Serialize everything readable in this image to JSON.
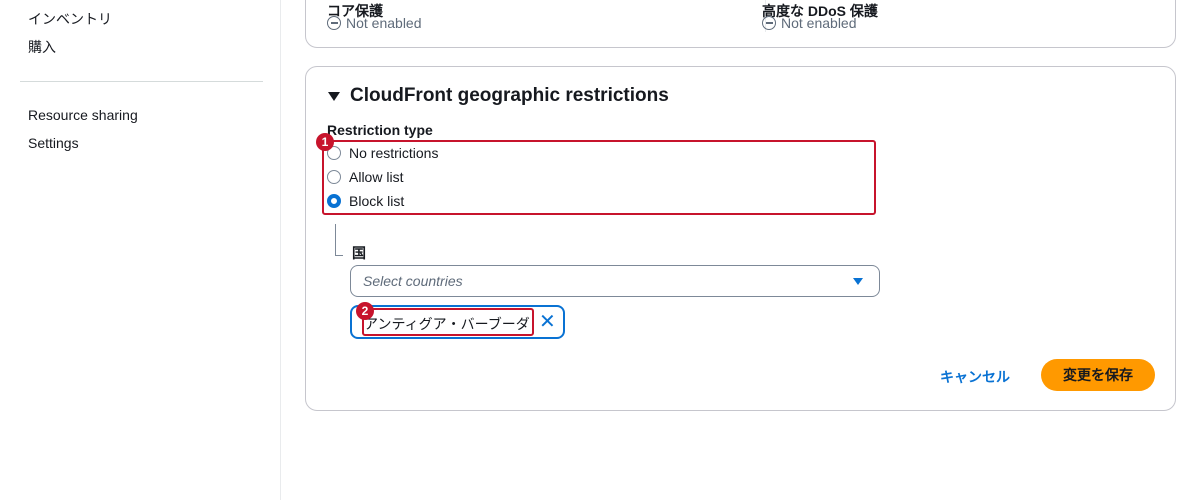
{
  "sidebar": {
    "items": [
      {
        "label": "インベントリ"
      },
      {
        "label": "購入"
      },
      {
        "label": "Resource sharing"
      },
      {
        "label": "Settings"
      }
    ]
  },
  "status_card": {
    "columns": [
      {
        "heading": "コア保護",
        "value": "Not enabled",
        "icon": "minus-circle-icon"
      },
      {
        "heading": "高度な DDoS 保護",
        "value": "Not enabled",
        "icon": "minus-circle-icon"
      }
    ]
  },
  "geo_card": {
    "title": "CloudFront geographic restrictions",
    "restriction_label": "Restriction type",
    "options": [
      {
        "label": "No restrictions",
        "checked": false
      },
      {
        "label": "Allow list",
        "checked": false
      },
      {
        "label": "Block list",
        "checked": true
      }
    ],
    "country_label": "国",
    "select_placeholder": "Select countries",
    "tokens": [
      {
        "label": "アンティグア・バーブーダ",
        "dismiss_icon": "close-icon"
      }
    ],
    "cancel_label": "キャンセル",
    "save_label": "変更を保存"
  },
  "annotations": {
    "badge_1": "1",
    "badge_2": "2"
  },
  "colors": {
    "accent": "#0972d3",
    "primary_button": "#ff9900",
    "highlight": "#c7142c",
    "border": "#c6c6cd"
  }
}
